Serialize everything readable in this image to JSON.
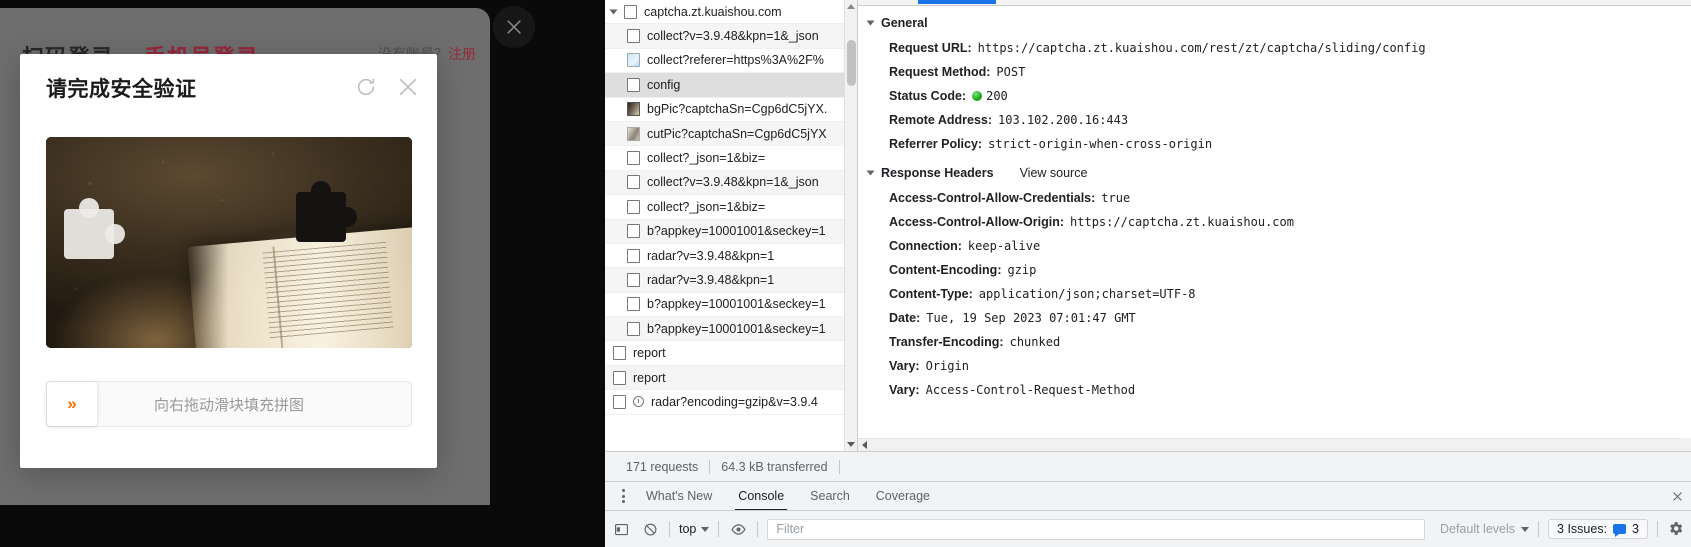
{
  "page": {
    "login_tabs": [
      {
        "label": "扫码登录",
        "active": false
      },
      {
        "label": "手机号登录",
        "active": true
      }
    ],
    "register_prompt": "没有账号？",
    "register_link": "注册",
    "overlay_close_icon": "close-icon"
  },
  "captcha": {
    "title": "请完成安全验证",
    "refresh_icon": "refresh-icon",
    "close_icon": "close-icon",
    "slider_handle_glyph": "»",
    "slider_hint": "向右拖动滑块填充拼图",
    "accent_color": "#ff6a00"
  },
  "devtools": {
    "requests": [
      {
        "name": "captcha.zt.kuaishou.com",
        "icon": "folder-icon",
        "type": "domain",
        "selected": false
      },
      {
        "name": "collect?v=3.9.48&kpn=1&_json",
        "icon": "document-icon",
        "type": "file",
        "selected": false
      },
      {
        "name": "collect?referer=https%3A%2F%",
        "icon": "image-icon",
        "type": "file",
        "selected": false
      },
      {
        "name": "config",
        "icon": "document-icon",
        "type": "file",
        "selected": true
      },
      {
        "name": "bgPic?captchaSn=Cgp6dC5jYX.",
        "icon": "picture-dark-icon",
        "type": "file",
        "selected": false
      },
      {
        "name": "cutPic?captchaSn=Cgp6dC5jYX",
        "icon": "picture-grey-icon",
        "type": "file",
        "selected": false
      },
      {
        "name": "collect?_json=1&biz=",
        "icon": "document-icon",
        "type": "file",
        "selected": false
      },
      {
        "name": "collect?v=3.9.48&kpn=1&_json",
        "icon": "document-icon",
        "type": "file",
        "selected": false
      },
      {
        "name": "collect?_json=1&biz=",
        "icon": "document-icon",
        "type": "file",
        "selected": false
      },
      {
        "name": "b?appkey=10001001&seckey=1",
        "icon": "document-icon",
        "type": "file",
        "selected": false
      },
      {
        "name": "radar?v=3.9.48&kpn=1",
        "icon": "document-icon",
        "type": "file",
        "selected": false
      },
      {
        "name": "radar?v=3.9.48&kpn=1",
        "icon": "document-icon",
        "type": "file",
        "selected": false
      },
      {
        "name": "b?appkey=10001001&seckey=1",
        "icon": "document-icon",
        "type": "file",
        "selected": false
      },
      {
        "name": "b?appkey=10001001&seckey=1",
        "icon": "document-icon",
        "type": "file",
        "selected": false
      },
      {
        "name": "report",
        "icon": "document-icon",
        "type": "root",
        "selected": false
      },
      {
        "name": "report",
        "icon": "document-icon",
        "type": "root",
        "selected": false
      },
      {
        "name": "radar?encoding=gzip&v=3.9.4",
        "icon": "pending-icon",
        "type": "root",
        "selected": false
      }
    ],
    "general": {
      "section_title": "General",
      "rows": [
        {
          "key": "Request URL:",
          "value": "https://captcha.zt.kuaishou.com/rest/zt/captcha/sliding/config"
        },
        {
          "key": "Request Method:",
          "value": "POST"
        },
        {
          "key": "Status Code:",
          "value": "200",
          "status_dot": true
        },
        {
          "key": "Remote Address:",
          "value": "103.102.200.16:443"
        },
        {
          "key": "Referrer Policy:",
          "value": "strict-origin-when-cross-origin"
        }
      ]
    },
    "response_headers": {
      "section_title": "Response Headers",
      "view_source": "View source",
      "rows": [
        {
          "key": "Access-Control-Allow-Credentials:",
          "value": "true"
        },
        {
          "key": "Access-Control-Allow-Origin:",
          "value": "https://captcha.zt.kuaishou.com"
        },
        {
          "key": "Connection:",
          "value": "keep-alive"
        },
        {
          "key": "Content-Encoding:",
          "value": "gzip"
        },
        {
          "key": "Content-Type:",
          "value": "application/json;charset=UTF-8"
        },
        {
          "key": "Date:",
          "value": "Tue, 19 Sep 2023 07:01:47 GMT"
        },
        {
          "key": "Transfer-Encoding:",
          "value": "chunked"
        },
        {
          "key": "Vary:",
          "value": "Origin"
        },
        {
          "key": "Vary:",
          "value": "Access-Control-Request-Method"
        }
      ]
    },
    "summary": {
      "requests": "171 requests",
      "transferred": "64.3 kB transferred"
    },
    "drawer_tabs": [
      {
        "label": "What's New",
        "active": false
      },
      {
        "label": "Console",
        "active": true
      },
      {
        "label": "Search",
        "active": false
      },
      {
        "label": "Coverage",
        "active": false
      }
    ],
    "console_bar": {
      "sidebar_icon": "sidebar-toggle-icon",
      "clear_icon": "clear-console-icon",
      "context": "top",
      "eye_icon": "live-expression-icon",
      "filter_placeholder": "Filter",
      "levels": "Default levels",
      "issues": "3 Issues:",
      "issues_count": "3",
      "settings_icon": "gear-icon"
    }
  }
}
